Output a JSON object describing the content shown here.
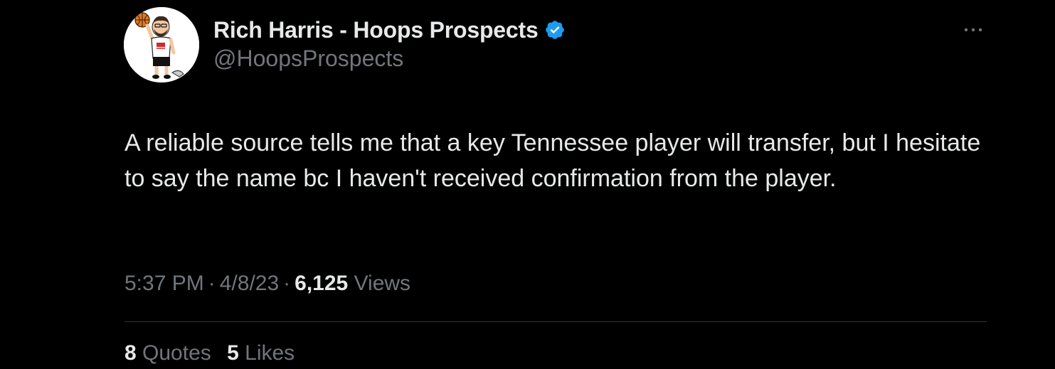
{
  "tweet": {
    "author": {
      "display_name": "Rich Harris - Hoops Prospects",
      "handle": "@HoopsProspects",
      "verified_icon": "verified-badge-icon",
      "avatar_icon": "cartoon-basketball-avatar"
    },
    "more_icon": "more-horizontal-icon",
    "text": "A reliable source tells me that a key Tennessee player will transfer, but I hesitate to say the name bc I haven't received confirmation from the player.",
    "time": "5:37 PM",
    "date": "4/8/23",
    "separator": "·",
    "views_count": "6,125",
    "views_label": "Views",
    "stats": {
      "quotes_count": "8",
      "quotes_label": "Quotes",
      "likes_count": "5",
      "likes_label": "Likes"
    }
  },
  "colors": {
    "background": "#000000",
    "primary_text": "#e7e9ea",
    "secondary_text": "#71767b",
    "verified_blue": "#1d9bf0",
    "divider": "#2f3336"
  }
}
